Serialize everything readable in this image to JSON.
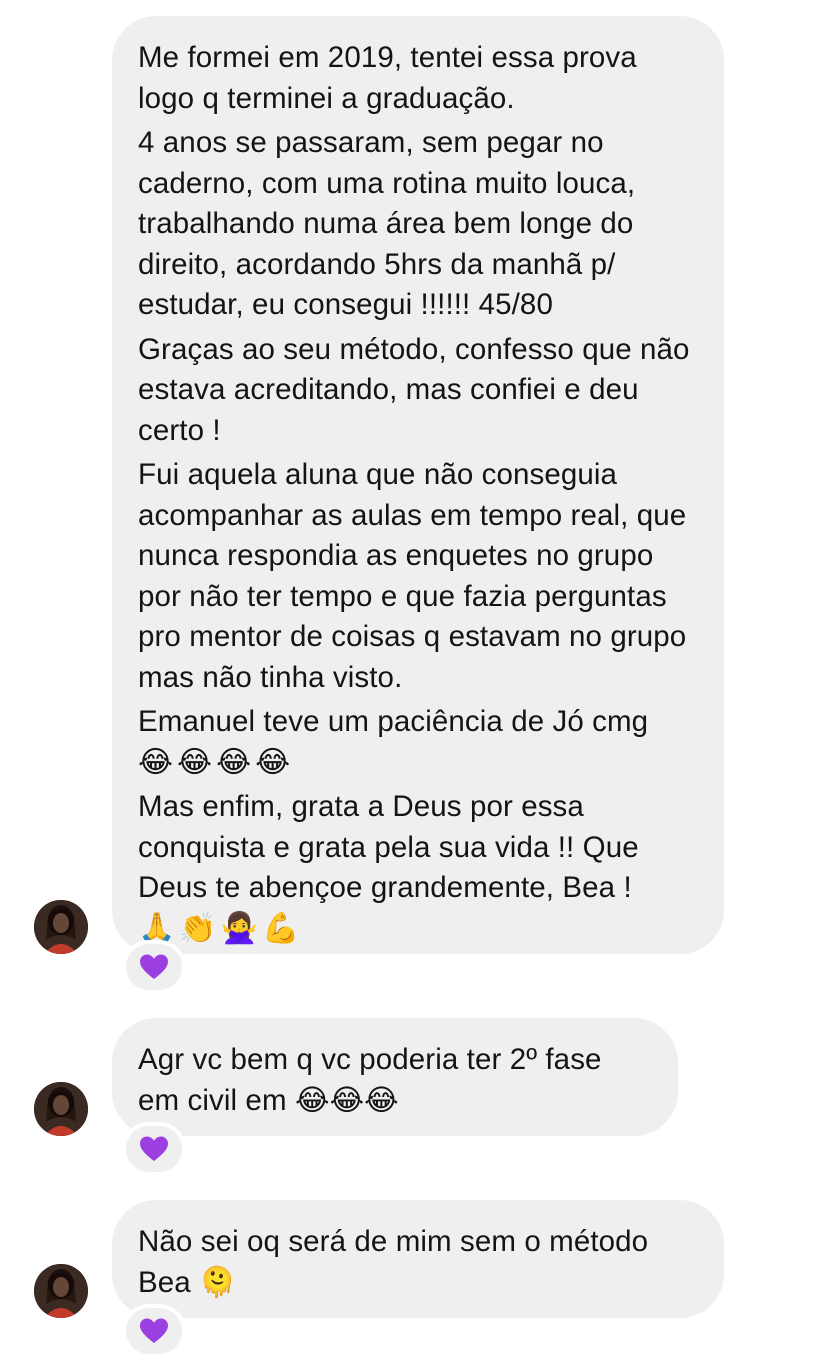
{
  "messages": [
    {
      "paragraphs": [
        "Me formei em 2019, tentei essa prova logo q terminei a graduação.",
        "4 anos se passaram, sem pegar no caderno, com uma rotina muito louca, trabalhando numa área bem longe do direito, acordando 5hrs da manhã p/ estudar, eu consegui !!!!!! 45/80",
        "Graças ao seu método, confesso que não estava acreditando, mas confiei e deu certo !",
        "Fui aquela aluna que não conseguia acompanhar as aulas em tempo real, que nunca respondia as enquetes no grupo por não ter tempo e que fazia perguntas pro mentor de coisas q estavam no grupo mas não tinha visto.",
        "Emanuel teve um paciência de Jó cmg",
        "😂😂😂😂",
        "Mas enfim, grata a Deus por essa conquista e grata pela sua vida !! Que Deus te abençoe grandemente, Bea !",
        "🙏👏🙅‍♀️💪"
      ],
      "reaction": "purple-heart-icon"
    },
    {
      "text": "Agr vc bem q vc poderia ter 2º fase em civil em 😂😂😂",
      "reaction": "purple-heart-icon"
    },
    {
      "text": "Não sei oq será de mim sem o método Bea 🫠",
      "reaction": "purple-heart-icon"
    }
  ],
  "colors": {
    "bubble": "#efefef",
    "text": "#141414",
    "reaction_heart": "#9b3fe0"
  }
}
